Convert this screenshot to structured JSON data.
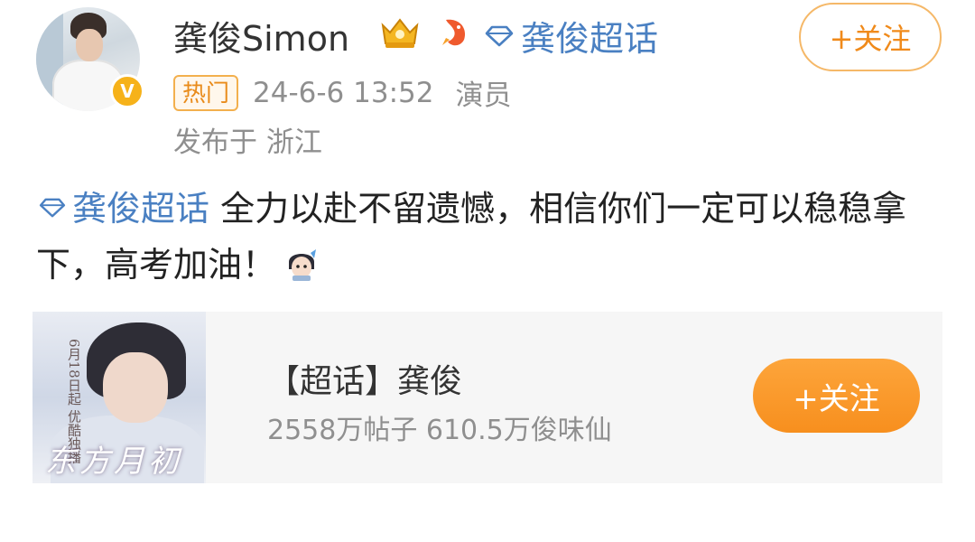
{
  "post": {
    "author": "龚俊Simon",
    "follow_label": "+关注",
    "topic_link": "龚俊超话",
    "hot_badge": "热门",
    "time": "24-6-6 13:52",
    "role": "演员",
    "location": "发布于 浙江",
    "content_topic": "龚俊超话",
    "content_text": " 全力以赴不留遗憾，相信你们一定可以稳稳拿下，高考加油！",
    "icons": [
      "verified-v-icon",
      "crown-badge-icon",
      "fish-badge-icon",
      "supertopic-diamond-icon",
      "sticker-emoji-icon"
    ]
  },
  "card": {
    "title": "【超话】龚俊",
    "stats": "2558万帖子 610.5万俊味仙",
    "follow_label": "+关注",
    "cover_vertical_text": "6月18日起 优酷独播",
    "cover_title": "东方月初"
  },
  "colors": {
    "link_blue": "#4a80c2",
    "follow_orange": "#f78f1e",
    "hot_badge": "#f3b04e"
  }
}
